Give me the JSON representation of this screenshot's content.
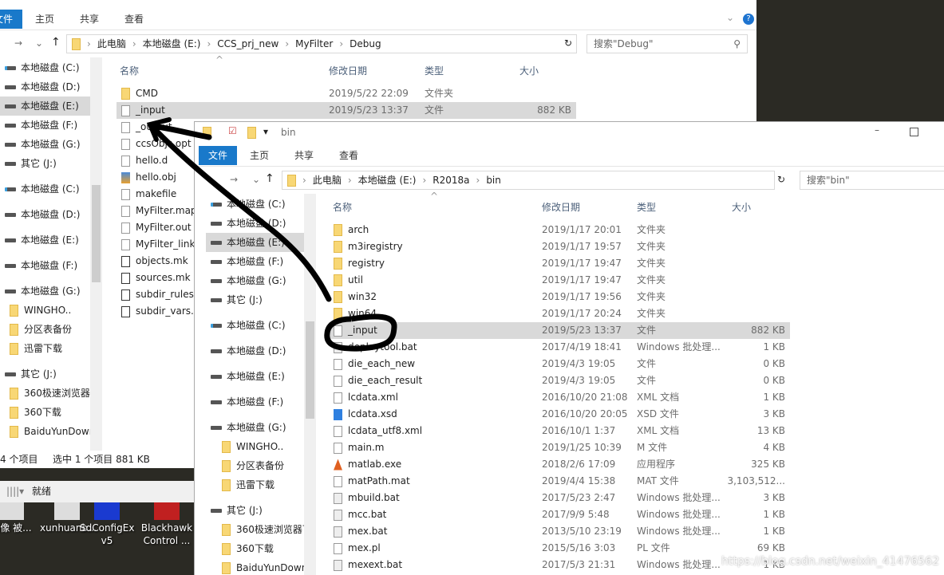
{
  "debug_window": {
    "title": "Debug",
    "tabs": [
      "文件",
      "主页",
      "共享",
      "查看"
    ],
    "breadcrumb": [
      "此电脑",
      "本地磁盘 (E:)",
      "CCS_prj_new",
      "MyFilter",
      "Debug"
    ],
    "search_placeholder": "搜索\"Debug\"",
    "columns": {
      "name": "名称",
      "date": "修改日期",
      "type": "类型",
      "size": "大小"
    },
    "files": [
      {
        "name": "CMD",
        "date": "2019/5/22 22:09",
        "type": "文件夹",
        "size": "",
        "icon": "folder"
      },
      {
        "name": "_input",
        "date": "2019/5/23 13:37",
        "type": "文件",
        "size": "882 KB",
        "icon": "file",
        "selected": true
      },
      {
        "name": "_output",
        "icon": "file"
      },
      {
        "name": "ccsObjs.opt",
        "icon": "file"
      },
      {
        "name": "hello.d",
        "icon": "file"
      },
      {
        "name": "hello.obj",
        "icon": "archive"
      },
      {
        "name": "makefile",
        "icon": "file"
      },
      {
        "name": "MyFilter.map",
        "icon": "text"
      },
      {
        "name": "MyFilter.out",
        "icon": "file"
      },
      {
        "name": "MyFilter_link",
        "icon": "file"
      },
      {
        "name": "objects.mk",
        "icon": "makefile"
      },
      {
        "name": "sources.mk",
        "icon": "makefile"
      },
      {
        "name": "subdir_rules",
        "icon": "makefile"
      },
      {
        "name": "subdir_vars.",
        "icon": "makefile"
      }
    ],
    "nav": [
      {
        "label": "本地磁盘 (C:)",
        "icon": "system-drive"
      },
      {
        "label": "本地磁盘 (D:)",
        "icon": "drive"
      },
      {
        "label": "本地磁盘 (E:)",
        "icon": "drive",
        "selected": true
      },
      {
        "label": "本地磁盘 (F:)",
        "icon": "drive"
      },
      {
        "label": "本地磁盘 (G:)",
        "icon": "drive"
      },
      {
        "label": "其它 (J:)",
        "icon": "drive"
      },
      {
        "label": "本地磁盘 (C:)",
        "icon": "system-drive"
      },
      {
        "label": "本地磁盘 (D:)",
        "icon": "drive"
      },
      {
        "label": "本地磁盘 (E:)",
        "icon": "drive"
      },
      {
        "label": "本地磁盘 (F:)",
        "icon": "drive"
      },
      {
        "label": "本地磁盘 (G:)",
        "icon": "drive"
      },
      {
        "label": "WINGHO..",
        "icon": "folder"
      },
      {
        "label": "分区表备份",
        "icon": "folder"
      },
      {
        "label": "迅雷下载",
        "icon": "folder"
      },
      {
        "label": "其它 (J:)",
        "icon": "drive"
      },
      {
        "label": "360极速浏览器下载",
        "icon": "folder"
      },
      {
        "label": "360下载",
        "icon": "folder"
      },
      {
        "label": "BaiduYunDownload",
        "icon": "folder"
      }
    ],
    "status": {
      "count": "4 个项目",
      "selected": "选中 1 个项目  881 KB"
    }
  },
  "bin_window": {
    "title": "bin",
    "tabs": [
      "文件",
      "主页",
      "共享",
      "查看"
    ],
    "breadcrumb": [
      "此电脑",
      "本地磁盘 (E:)",
      "R2018a",
      "bin"
    ],
    "search_placeholder": "搜索\"bin\"",
    "columns": {
      "name": "名称",
      "date": "修改日期",
      "type": "类型",
      "size": "大小"
    },
    "files": [
      {
        "name": "arch",
        "date": "2019/1/17 20:01",
        "type": "文件夹",
        "size": "",
        "icon": "folder"
      },
      {
        "name": "m3iregistry",
        "date": "2019/1/17 19:57",
        "type": "文件夹",
        "size": "",
        "icon": "folder"
      },
      {
        "name": "registry",
        "date": "2019/1/17 19:47",
        "type": "文件夹",
        "size": "",
        "icon": "folder"
      },
      {
        "name": "util",
        "date": "2019/1/17 19:47",
        "type": "文件夹",
        "size": "",
        "icon": "folder"
      },
      {
        "name": "win32",
        "date": "2019/1/17 19:56",
        "type": "文件夹",
        "size": "",
        "icon": "folder"
      },
      {
        "name": "win64",
        "date": "2019/1/17 20:24",
        "type": "文件夹",
        "size": "",
        "icon": "folder"
      },
      {
        "name": "_input",
        "date": "2019/5/23 13:37",
        "type": "文件",
        "size": "882 KB",
        "icon": "file",
        "selected": true
      },
      {
        "name": "deploytool.bat",
        "date": "2017/4/19 18:41",
        "type": "Windows 批处理...",
        "size": "1 KB",
        "icon": "batch"
      },
      {
        "name": "die_each_new",
        "date": "2019/4/3 19:05",
        "type": "文件",
        "size": "0 KB",
        "icon": "file"
      },
      {
        "name": "die_each_result",
        "date": "2019/4/3 19:05",
        "type": "文件",
        "size": "0 KB",
        "icon": "file"
      },
      {
        "name": "lcdata.xml",
        "date": "2016/10/20 21:08",
        "type": "XML 文档",
        "size": "1 KB",
        "icon": "file"
      },
      {
        "name": "lcdata.xsd",
        "date": "2016/10/20 20:05",
        "type": "XSD 文件",
        "size": "3 KB",
        "icon": "xsd"
      },
      {
        "name": "lcdata_utf8.xml",
        "date": "2016/10/1 1:37",
        "type": "XML 文档",
        "size": "13 KB",
        "icon": "file"
      },
      {
        "name": "main.m",
        "date": "2019/1/25 10:39",
        "type": "M 文件",
        "size": "4 KB",
        "icon": "file"
      },
      {
        "name": "matlab.exe",
        "date": "2018/2/6 17:09",
        "type": "应用程序",
        "size": "325 KB",
        "icon": "matlab"
      },
      {
        "name": "matPath.mat",
        "date": "2019/4/4 15:38",
        "type": "MAT 文件",
        "size": "3,103,512...",
        "icon": "file"
      },
      {
        "name": "mbuild.bat",
        "date": "2017/5/23 2:47",
        "type": "Windows 批处理...",
        "size": "3 KB",
        "icon": "batch"
      },
      {
        "name": "mcc.bat",
        "date": "2017/9/9 5:48",
        "type": "Windows 批处理...",
        "size": "1 KB",
        "icon": "batch"
      },
      {
        "name": "mex.bat",
        "date": "2013/5/10 23:19",
        "type": "Windows 批处理...",
        "size": "1 KB",
        "icon": "batch"
      },
      {
        "name": "mex.pl",
        "date": "2015/5/16 3:03",
        "type": "PL 文件",
        "size": "69 KB",
        "icon": "file"
      },
      {
        "name": "mexext.bat",
        "date": "2017/5/3 21:31",
        "type": "Windows 批处理...",
        "size": "1 KB",
        "icon": "batch"
      }
    ],
    "nav": [
      {
        "label": "本地磁盘 (C:)",
        "icon": "system-drive"
      },
      {
        "label": "本地磁盘 (D:)",
        "icon": "drive"
      },
      {
        "label": "本地磁盘 (E:)",
        "icon": "drive",
        "selected": true
      },
      {
        "label": "本地磁盘 (F:)",
        "icon": "drive"
      },
      {
        "label": "本地磁盘 (G:)",
        "icon": "drive"
      },
      {
        "label": "其它 (J:)",
        "icon": "drive"
      },
      {
        "label": "本地磁盘 (C:)",
        "icon": "system-drive"
      },
      {
        "label": "本地磁盘 (D:)",
        "icon": "drive"
      },
      {
        "label": "本地磁盘 (E:)",
        "icon": "drive"
      },
      {
        "label": "本地磁盘 (F:)",
        "icon": "drive"
      },
      {
        "label": "本地磁盘 (G:)",
        "icon": "drive"
      },
      {
        "label": "WINGHO..",
        "icon": "folder"
      },
      {
        "label": "分区表备份",
        "icon": "folder"
      },
      {
        "label": "迅雷下载",
        "icon": "folder"
      },
      {
        "label": "其它 (J:)",
        "icon": "drive"
      },
      {
        "label": "360极速浏览器下载",
        "icon": "folder"
      },
      {
        "label": "360下载",
        "icon": "folder"
      },
      {
        "label": "BaiduYunDownload",
        "icon": "folder"
      }
    ]
  },
  "background_app": {
    "status": "就绪"
  },
  "desktop_icons": [
    {
      "label": "摄像 被..."
    },
    {
      "label": "xunhuanb..."
    },
    {
      "label": "SdConfigEx v5"
    },
    {
      "label": "Blackhawk Control ..."
    }
  ],
  "watermark": "https://blog.csdn.net/weixin_41476562",
  "colors": {
    "accent": "#1979ca",
    "selection": "#d9d9d9",
    "annotation": "#000000"
  }
}
